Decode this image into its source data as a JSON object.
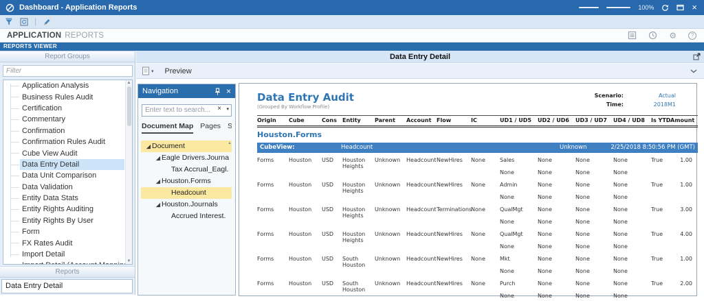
{
  "titlebar": {
    "app_title": "Dashboard - Application Reports",
    "zoom_value": "100%"
  },
  "app_header": {
    "word1": "APPLICATION",
    "word2": "REPORTS"
  },
  "viewer_bar": {
    "label": "REPORTS VIEWER"
  },
  "sidebar": {
    "groups_header": "Report Groups",
    "filter_placeholder": "Filter",
    "selected_group": "Data Entry Detail",
    "groups": [
      "Application Analysis",
      "Business Rules Audit",
      "Certification",
      "Commentary",
      "Confirmation",
      "Confirmation Rules Audit",
      "Cube View Audit",
      "Data Entry Detail",
      "Data Unit Comparison",
      "Data Validation",
      "Entity Data Stats",
      "Entity Rights Auditing",
      "Entity Rights By User",
      "Form",
      "FX Rates Audit",
      "Import Detail",
      "Import Detail (Account Mapping)"
    ],
    "reports_header": "Reports",
    "reports": [
      "Data Entry Detail"
    ]
  },
  "main": {
    "panel_title": "Data Entry Detail",
    "preview_label": "Preview"
  },
  "navigation": {
    "title": "Navigation",
    "search_placeholder": "Enter text to search...",
    "tabs": [
      {
        "label": "Document Map",
        "active": true
      },
      {
        "label": "Pages",
        "active": false
      },
      {
        "label": "Se",
        "active": false
      }
    ],
    "tree": [
      {
        "label": "Document",
        "level": 0,
        "expander": true,
        "highlight": true
      },
      {
        "label": "Eagle Drivers.Journa",
        "level": 1,
        "expander": true,
        "highlight": false
      },
      {
        "label": "Tax Accrual_Eagl.",
        "level": 2,
        "expander": false,
        "highlight": false
      },
      {
        "label": "Houston.Forms",
        "level": 1,
        "expander": true,
        "highlight": false
      },
      {
        "label": "Headcount",
        "level": 2,
        "expander": false,
        "highlight": true
      },
      {
        "label": "Houston.Journals",
        "level": 1,
        "expander": true,
        "highlight": false
      },
      {
        "label": "Accrued Interest.",
        "level": 2,
        "expander": false,
        "highlight": false
      }
    ]
  },
  "report": {
    "title": "Data Entry Audit",
    "subtitle": "(Grouped By Workflow Profile)",
    "meta": {
      "scenario_label": "Scenario:",
      "scenario_value": "Actual",
      "time_label": "Time:",
      "time_value": "2018M1"
    },
    "columns": [
      "Origin",
      "Cube",
      "Cons",
      "Entity",
      "Parent",
      "Account",
      "Flow",
      "IC",
      "UD1 / UD5",
      "UD2 / UD6",
      "UD3 / UD7",
      "UD4 / UD8",
      "Is YTD",
      "Amount"
    ],
    "group_title": "Houston.Forms",
    "cubeview": {
      "label": "CubeView:",
      "value": "Headcount",
      "status": "Unknown",
      "timestamp": "2/25/2018 8:50:56 PM (GMT)"
    },
    "rows": [
      {
        "origin": "Forms",
        "cube": "Houston",
        "cons": "USD",
        "entity": "Houston Heights",
        "parent": "Unknown",
        "account": "Headcount",
        "flow": "NewHires",
        "ic": "None",
        "ud1": "Sales",
        "ud2": "None",
        "ud3": "None",
        "ud4": "None",
        "is_ytd": "True",
        "amount": "1.00",
        "ud5": "None",
        "ud6": "None",
        "ud7": "None",
        "ud8": "None"
      },
      {
        "origin": "Forms",
        "cube": "Houston",
        "cons": "USD",
        "entity": "Houston Heights",
        "parent": "Unknown",
        "account": "Headcount",
        "flow": "NewHires",
        "ic": "None",
        "ud1": "Admin",
        "ud2": "None",
        "ud3": "None",
        "ud4": "None",
        "is_ytd": "True",
        "amount": "1.00",
        "ud5": "None",
        "ud6": "None",
        "ud7": "None",
        "ud8": "None"
      },
      {
        "origin": "Forms",
        "cube": "Houston",
        "cons": "USD",
        "entity": "Houston Heights",
        "parent": "Unknown",
        "account": "Headcount",
        "flow": "Terminations",
        "ic": "None",
        "ud1": "QualMgt",
        "ud2": "None",
        "ud3": "None",
        "ud4": "None",
        "is_ytd": "True",
        "amount": "3.00",
        "ud5": "None",
        "ud6": "None",
        "ud7": "None",
        "ud8": "None"
      },
      {
        "origin": "Forms",
        "cube": "Houston",
        "cons": "USD",
        "entity": "Houston Heights",
        "parent": "Unknown",
        "account": "Headcount",
        "flow": "NewHires",
        "ic": "None",
        "ud1": "QualMgt",
        "ud2": "None",
        "ud3": "None",
        "ud4": "None",
        "is_ytd": "True",
        "amount": "4.00",
        "ud5": "None",
        "ud6": "None",
        "ud7": "None",
        "ud8": "None"
      },
      {
        "origin": "Forms",
        "cube": "Houston",
        "cons": "USD",
        "entity": "South Houston",
        "parent": "Unknown",
        "account": "Headcount",
        "flow": "NewHires",
        "ic": "None",
        "ud1": "Mkt",
        "ud2": "None",
        "ud3": "None",
        "ud4": "None",
        "is_ytd": "True",
        "amount": "1.00",
        "ud5": "None",
        "ud6": "None",
        "ud7": "None",
        "ud8": "None"
      },
      {
        "origin": "Forms",
        "cube": "Houston",
        "cons": "USD",
        "entity": "South Houston",
        "parent": "Unknown",
        "account": "Headcount",
        "flow": "NewHires",
        "ic": "None",
        "ud1": "Purch",
        "ud2": "None",
        "ud3": "None",
        "ud4": "None",
        "is_ytd": "True",
        "amount": "2.00",
        "ud5": "None",
        "ud6": "None",
        "ud7": "None",
        "ud8": "None"
      }
    ]
  },
  "colors": {
    "titlebar_blue": "#2769ac",
    "header_blue": "#2a6dad",
    "cubeview_blue": "#3f80c2",
    "highlight_yellow": "#fce9a1",
    "selection_blue": "#cde3f8",
    "link_blue": "#2e75b5"
  }
}
